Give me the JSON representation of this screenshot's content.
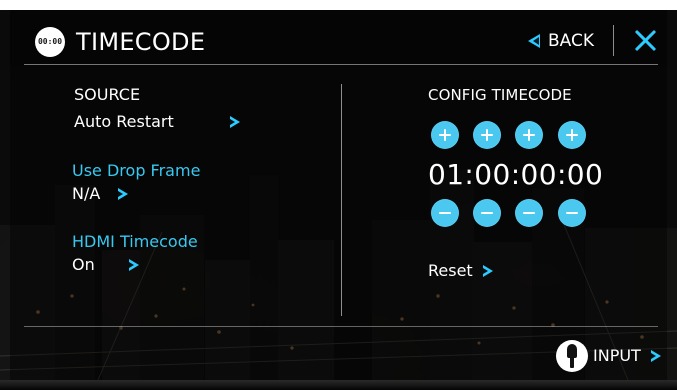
{
  "header": {
    "badge_text": "00:00",
    "title": "TIMECODE",
    "back_label": "BACK",
    "close_icon": "close-icon",
    "back_icon": "chevron-left-icon",
    "badge_icon": "timecode-badge-icon"
  },
  "left_panel": {
    "source_label": "SOURCE",
    "source_value": "Auto Restart",
    "use_drop_frame_label": "Use Drop Frame",
    "use_drop_frame_value": "N/A",
    "hdmi_timecode_label": "HDMI Timecode",
    "hdmi_timecode_value": "On",
    "chevron_icon": "chevron-right-icon"
  },
  "right_panel": {
    "title": "CONFIG TIMECODE",
    "time_value": "01:00:00:00",
    "reset_label": "Reset",
    "plus_icon": "plus-icon",
    "minus_icon": "minus-icon"
  },
  "footer": {
    "input_label": "INPUT",
    "input_icon": "input-plug-icon"
  },
  "colors": {
    "accent": "#39c8f0",
    "button_fill": "#4bc8ef",
    "text": "#ffffff",
    "background": "#101112"
  }
}
